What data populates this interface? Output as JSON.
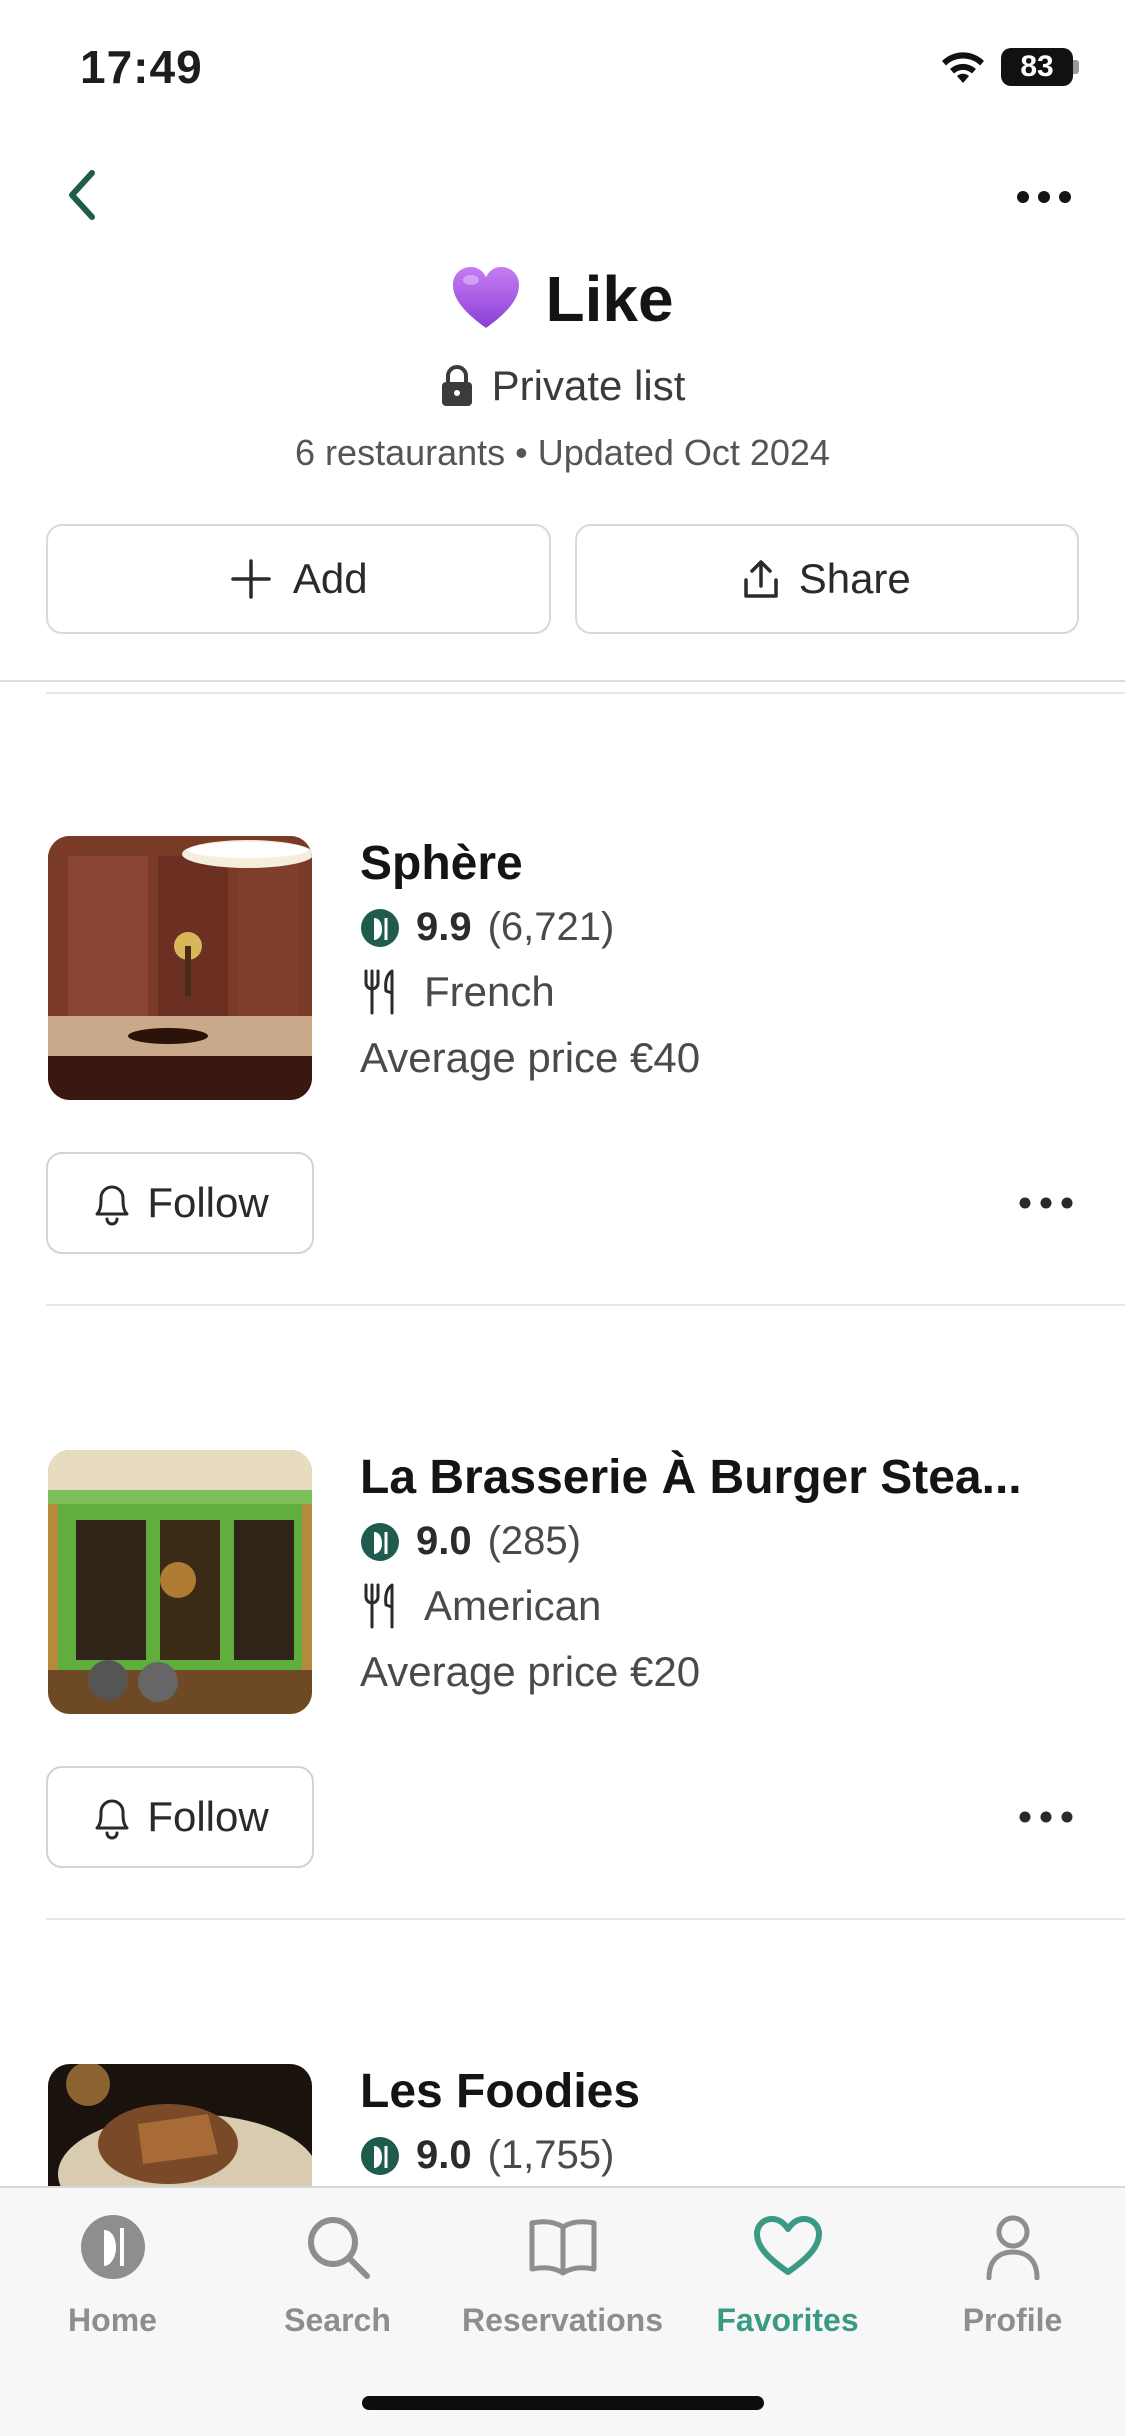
{
  "status_bar": {
    "time": "17:49",
    "battery": "83"
  },
  "header": {
    "emoji": "💜",
    "title": "Like",
    "privacy": "Private list",
    "meta": "6 restaurants • Updated Oct 2024"
  },
  "actions": {
    "add_label": "Add",
    "share_label": "Share"
  },
  "restaurants": [
    {
      "name": "Sphère",
      "score": "9.9",
      "reviews": "(6,721)",
      "cuisine": "French",
      "price": "Average price €40",
      "follow_label": "Follow"
    },
    {
      "name": "La Brasserie À Burger Stea...",
      "score": "9.0",
      "reviews": "(285)",
      "cuisine": "American",
      "price": "Average price €20",
      "follow_label": "Follow"
    },
    {
      "name": "Les Foodies",
      "score": "9.0",
      "reviews": "(1,755)"
    }
  ],
  "tabs": [
    {
      "label": "Home",
      "icon": "fork-knife-icon",
      "active": false
    },
    {
      "label": "Search",
      "icon": "search-icon",
      "active": false
    },
    {
      "label": "Reservations",
      "icon": "book-icon",
      "active": false
    },
    {
      "label": "Favorites",
      "icon": "heart-icon",
      "active": true
    },
    {
      "label": "Profile",
      "icon": "person-icon",
      "active": false
    }
  ],
  "colors": {
    "accent": "#3a9a84",
    "dark_green": "#1f5c4d",
    "inactive": "#8e8e8e"
  }
}
